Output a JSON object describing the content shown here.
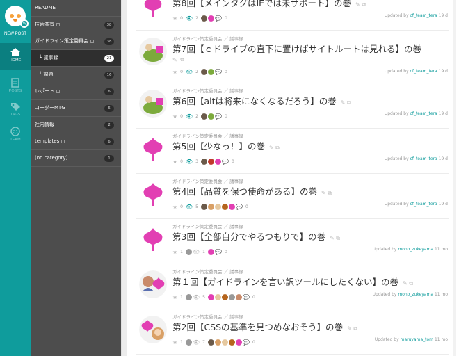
{
  "rail": {
    "new_post": "NEW POST",
    "home": "HOME",
    "posts": "POSTS",
    "tags": "TAGS",
    "team": "TEAM"
  },
  "sidebar": {
    "items": [
      {
        "label": "README",
        "count": ""
      },
      {
        "label": "技術共有",
        "count": "38"
      },
      {
        "label": "ガイドライン策定委員会",
        "count": "38"
      },
      {
        "label": "└ 議事録",
        "count": "21"
      },
      {
        "label": "└ 課題",
        "count": "16"
      },
      {
        "label": "レポート",
        "count": "6"
      },
      {
        "label": "コーダーMTG",
        "count": "6"
      },
      {
        "label": "社内情報",
        "count": "2"
      },
      {
        "label": "templates",
        "count": "6"
      },
      {
        "label": "(no category)",
        "count": "1"
      }
    ]
  },
  "posts": [
    {
      "category": "",
      "title": "第8回【メインタグはIEでは未サポート】の巻",
      "stars": "0",
      "views": "2",
      "comments": "0",
      "updated_by": "cf_team_tera",
      "ago": "19 d"
    },
    {
      "category": "ガイドライン策定委員会 ／ 議事録",
      "title": "第7回【ｃドライブの直下に置けばサイトルートは見れる】の巻",
      "stars": "0",
      "views": "2",
      "comments": "0",
      "updated_by": "cf_team_tera",
      "ago": "19 d"
    },
    {
      "category": "ガイドライン策定委員会 ／ 議事録",
      "title": "第6回【altは将来になくなるだろう】の巻",
      "stars": "0",
      "views": "2",
      "comments": "0",
      "updated_by": "cf_team_tera",
      "ago": "19 d"
    },
    {
      "category": "ガイドライン策定委員会 ／ 議事録",
      "title": "第5回【少なっ！】の巻",
      "stars": "0",
      "views": "3",
      "comments": "0",
      "updated_by": "cf_team_tera",
      "ago": "19 d"
    },
    {
      "category": "ガイドライン策定委員会 ／ 議事録",
      "title": "第4回【品質を保つ使命がある】の巻",
      "stars": "0",
      "views": "5",
      "comments": "0",
      "updated_by": "cf_team_tera",
      "ago": "19 d"
    },
    {
      "category": "ガイドライン策定委員会 ／ 議事録",
      "title": "第3回【全部自分でやるつもりで】の巻",
      "stars": "1",
      "views": "1",
      "comments": "0",
      "updated_by": "mono_zukeyama",
      "ago": "11 mo"
    },
    {
      "category": "ガイドライン策定委員会 ／ 議事録",
      "title": "第１回【ガイドラインを言い訳ツールにしたくない】の巻",
      "stars": "1",
      "views": "5",
      "comments": "0",
      "updated_by": "mono_zukeyama",
      "ago": "11 mo"
    },
    {
      "category": "ガイドライン策定委員会 ／ 議事録",
      "title": "第2回【CSSの基準を見つめなおそう】の巻",
      "stars": "1",
      "views": "7",
      "comments": "0",
      "updated_by": "maruyama_tom",
      "ago": "11 mo"
    }
  ],
  "updated_prefix": "Updated by",
  "colors": {
    "teal": "#0f9c9c",
    "sidebar": "#4d4d4d",
    "pink": "#e23fb3"
  }
}
